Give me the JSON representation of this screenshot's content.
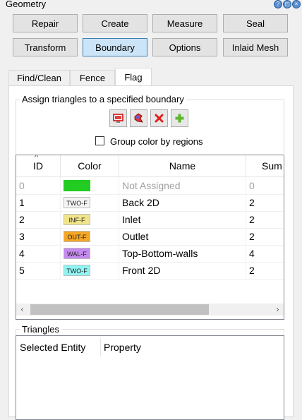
{
  "window": {
    "title": "Geometry"
  },
  "toolbar": {
    "row1": [
      "Repair",
      "Create",
      "Measure",
      "Seal"
    ],
    "row2": [
      "Transform",
      "Boundary",
      "Options",
      "Inlaid Mesh"
    ],
    "active": "Boundary"
  },
  "tabs": [
    "Find/Clean",
    "Fence",
    "Flag"
  ],
  "active_tab": "Flag",
  "assign_group": {
    "label": "Assign triangles to a specified boundary",
    "tools": [
      "display-icon",
      "region-icon",
      "delete-icon",
      "add-icon"
    ],
    "group_color_checkbox": {
      "label": "Group color by regions",
      "checked": false
    }
  },
  "boundary_table": {
    "columns": [
      "ID",
      "Color",
      "Name",
      "Sum"
    ],
    "sort_indicator": "ID",
    "rows": [
      {
        "id": "0",
        "color_label": "",
        "color": "#22cc22",
        "name": "Not Assigned",
        "sum": "0",
        "disabled": true
      },
      {
        "id": "1",
        "color_label": "TWO-F",
        "color": "#f4f4f4",
        "name": "Back 2D",
        "sum": "2"
      },
      {
        "id": "2",
        "color_label": "INF-F",
        "color": "#f2e48a",
        "name": "Inlet",
        "sum": "2"
      },
      {
        "id": "3",
        "color_label": "OUT-F",
        "color": "#f5a623",
        "name": "Outlet",
        "sum": "2"
      },
      {
        "id": "4",
        "color_label": "WAL-F",
        "color": "#c58af0",
        "name": "Top-Bottom-walls",
        "sum": "4"
      },
      {
        "id": "5",
        "color_label": "TWO-F",
        "color": "#8ff5f2",
        "name": "Front 2D",
        "sum": "2"
      }
    ]
  },
  "triangles_group": {
    "label": "Triangles",
    "columns": [
      "Selected Entity",
      "Property"
    ]
  }
}
